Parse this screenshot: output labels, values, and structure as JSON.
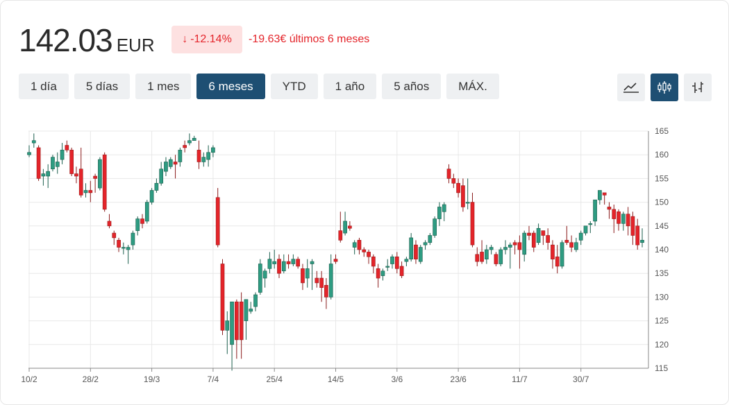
{
  "header": {
    "price": "142.03",
    "currency": "EUR",
    "change_pct": "-12.14%",
    "change_abs": "-19.63€ últimos 6 meses",
    "down_color": "#e4242a"
  },
  "ranges": [
    {
      "label": "1 día",
      "active": false
    },
    {
      "label": "5 días",
      "active": false
    },
    {
      "label": "1 mes",
      "active": false
    },
    {
      "label": "6 meses",
      "active": true
    },
    {
      "label": "YTD",
      "active": false
    },
    {
      "label": "1 año",
      "active": false
    },
    {
      "label": "5 años",
      "active": false
    },
    {
      "label": "MÁX.",
      "active": false
    }
  ],
  "chart_types": [
    {
      "name": "line-chart-icon",
      "active": false
    },
    {
      "name": "candlestick-chart-icon",
      "active": true
    },
    {
      "name": "ohlc-chart-icon",
      "active": false
    }
  ],
  "chart_data": {
    "type": "candlestick",
    "up_color": "#2e9c82",
    "down_color": "#e4242a",
    "ylim": [
      115,
      165
    ],
    "yticks": [
      115,
      120,
      125,
      130,
      135,
      140,
      145,
      150,
      155,
      160,
      165
    ],
    "xticks": [
      {
        "label": "10/2",
        "index": 0
      },
      {
        "label": "28/2",
        "index": 13
      },
      {
        "label": "19/3",
        "index": 26
      },
      {
        "label": "7/4",
        "index": 39
      },
      {
        "label": "25/4",
        "index": 52
      },
      {
        "label": "14/5",
        "index": 65
      },
      {
        "label": "3/6",
        "index": 78
      },
      {
        "label": "23/6",
        "index": 91
      },
      {
        "label": "11/7",
        "index": 104
      },
      {
        "label": "30/7",
        "index": 117
      }
    ],
    "candles": [
      [
        160,
        162,
        160.5,
        159.5
      ],
      [
        162.5,
        164.5,
        163,
        161.5
      ],
      [
        161.5,
        162,
        155,
        154.5
      ],
      [
        155.5,
        157,
        156,
        153.5
      ],
      [
        155.5,
        158,
        156.5,
        153
      ],
      [
        157,
        160,
        159.5,
        156.5
      ],
      [
        157.5,
        160.5,
        158.5,
        156
      ],
      [
        159,
        162.5,
        161,
        158
      ],
      [
        162,
        163,
        161,
        160.5
      ],
      [
        161,
        161.5,
        156,
        155.5
      ],
      [
        156,
        157.5,
        155.5,
        154
      ],
      [
        157,
        161.5,
        151.5,
        151
      ],
      [
        152,
        154,
        152.5,
        151
      ],
      [
        152.5,
        154.5,
        152,
        150
      ],
      [
        155.5,
        156,
        155,
        152
      ],
      [
        153,
        159.5,
        159,
        152.5
      ],
      [
        160,
        160.5,
        148.5,
        148
      ],
      [
        146,
        147.5,
        145,
        144.5
      ],
      [
        143.5,
        144,
        142.5,
        141
      ],
      [
        142,
        142.5,
        140.5,
        139.5
      ],
      [
        140.5,
        141.5,
        140.5,
        139
      ],
      [
        140,
        141,
        140.5,
        137
      ],
      [
        141,
        144,
        143.5,
        140
      ],
      [
        144,
        147,
        146.5,
        143
      ],
      [
        146.5,
        147.5,
        145.5,
        144.5
      ],
      [
        146,
        150.5,
        150,
        145.5
      ],
      [
        150,
        153,
        152.5,
        149.5
      ],
      [
        152.5,
        155,
        154,
        152
      ],
      [
        154,
        158.5,
        157,
        153.5
      ],
      [
        156.5,
        159.5,
        158.5,
        155.5
      ],
      [
        157.5,
        159.5,
        159,
        157
      ],
      [
        158.5,
        160,
        158,
        155
      ],
      [
        158.5,
        161.5,
        161,
        157.5
      ],
      [
        162,
        163,
        161.5,
        160.5
      ],
      [
        162.5,
        164.5,
        163,
        162
      ],
      [
        163,
        164,
        163.5,
        163
      ],
      [
        161,
        163,
        158.5,
        157
      ],
      [
        158.5,
        160.5,
        159.5,
        157.5
      ],
      [
        159,
        162,
        160.5,
        157.5
      ],
      [
        160.5,
        162,
        161.5,
        159.5
      ],
      [
        151,
        153,
        141,
        140.5
      ],
      [
        137,
        138,
        123,
        122
      ],
      [
        123,
        127,
        125,
        118
      ],
      [
        120,
        129,
        129,
        114.5
      ],
      [
        129,
        129.5,
        121,
        117
      ],
      [
        129,
        131,
        121,
        117
      ],
      [
        125,
        128,
        129.5,
        121
      ],
      [
        127,
        129,
        127.5,
        126.5
      ],
      [
        128,
        131,
        130.5,
        127
      ],
      [
        131,
        138,
        137,
        130.5
      ],
      [
        134,
        136,
        135.5,
        132
      ],
      [
        136,
        139.5,
        138,
        135
      ],
      [
        137,
        140,
        137.5,
        136
      ],
      [
        138,
        139,
        135,
        134
      ],
      [
        135.5,
        139,
        137.5,
        135
      ],
      [
        137.5,
        139,
        137,
        136
      ],
      [
        137,
        139,
        138,
        136.5
      ],
      [
        138,
        138.5,
        136.5,
        136
      ],
      [
        136,
        137,
        133,
        131.5
      ],
      [
        134,
        138,
        136,
        132
      ],
      [
        137,
        138,
        137.5,
        131.5
      ],
      [
        134,
        135.5,
        133,
        132
      ],
      [
        134,
        135.5,
        132,
        129
      ],
      [
        132.5,
        134,
        130,
        127.5
      ],
      [
        130,
        139,
        137,
        129.5
      ],
      [
        138,
        139,
        137.5,
        137
      ],
      [
        144,
        148,
        142,
        141.5
      ],
      [
        143.5,
        148,
        146,
        143
      ],
      [
        145,
        146,
        144.5,
        144
      ],
      [
        140.5,
        142,
        141.5,
        139
      ],
      [
        142,
        142.5,
        140,
        139
      ],
      [
        140,
        140.5,
        139.5,
        138.5
      ],
      [
        139.5,
        140,
        138.5,
        137
      ],
      [
        138.5,
        139,
        136.5,
        135
      ],
      [
        136,
        137,
        134,
        132
      ],
      [
        134.5,
        136,
        135.5,
        133.5
      ],
      [
        136.5,
        138,
        136.5,
        135.5
      ],
      [
        137,
        139,
        138.5,
        136
      ],
      [
        138.5,
        139.5,
        136,
        135
      ],
      [
        136.5,
        137.5,
        134.5,
        134
      ],
      [
        137.5,
        138.5,
        138,
        136.5
      ],
      [
        138,
        143.5,
        142.5,
        137.5
      ],
      [
        141,
        142,
        138,
        137
      ],
      [
        137.5,
        141,
        140.5,
        137
      ],
      [
        141,
        142,
        141.5,
        140
      ],
      [
        141.5,
        143.5,
        143,
        141
      ],
      [
        143,
        147,
        146.5,
        142.5
      ],
      [
        146.5,
        150,
        149,
        145
      ],
      [
        148,
        150,
        149.5,
        146
      ],
      [
        157,
        158,
        155,
        154
      ],
      [
        155,
        156,
        154,
        153
      ],
      [
        154,
        155,
        152,
        151
      ],
      [
        153.5,
        155,
        149,
        148
      ],
      [
        150,
        155,
        150,
        148.5
      ],
      [
        150,
        152,
        141,
        140.5
      ],
      [
        139,
        140.5,
        137.5,
        136.5
      ],
      [
        139.5,
        142,
        137.5,
        137
      ],
      [
        138,
        141,
        140,
        137
      ],
      [
        140,
        141,
        140.5,
        139
      ],
      [
        139,
        139.5,
        137,
        136.5
      ],
      [
        137,
        140.5,
        140,
        136.5
      ],
      [
        140,
        142,
        140.5,
        139
      ],
      [
        140.5,
        141.5,
        141,
        136
      ],
      [
        141.5,
        142,
        141,
        139
      ],
      [
        141.5,
        143,
        140,
        136
      ],
      [
        139,
        144,
        143.5,
        137.5
      ],
      [
        143.5,
        145,
        143,
        142
      ],
      [
        143.5,
        144,
        140.5,
        139.5
      ],
      [
        141.5,
        145.5,
        144.5,
        141
      ],
      [
        144,
        144,
        143,
        141
      ],
      [
        143,
        144.5,
        141.5,
        140
      ],
      [
        141,
        142,
        138,
        136
      ],
      [
        138.5,
        141,
        136.5,
        135
      ],
      [
        136.5,
        142,
        141.5,
        136
      ],
      [
        142,
        145,
        141.5,
        141
      ],
      [
        141.5,
        143,
        140.5,
        139.5
      ],
      [
        140,
        142.5,
        141.5,
        139.5
      ],
      [
        142,
        144,
        143.5,
        141
      ],
      [
        143.5,
        145,
        145,
        143
      ],
      [
        145.5,
        146,
        145.5,
        143.5
      ],
      [
        146,
        150.5,
        150.5,
        145
      ],
      [
        150.5,
        152.5,
        152.5,
        149.5
      ],
      [
        152,
        151.5,
        151.5,
        149.5
      ],
      [
        149,
        150,
        148.5,
        146.5
      ],
      [
        148.5,
        149.5,
        146.5,
        143.5
      ],
      [
        148,
        148.5,
        145.5,
        144
      ],
      [
        145.5,
        148,
        147.5,
        144
      ],
      [
        147.5,
        149,
        145,
        143
      ],
      [
        147,
        148,
        143,
        141
      ],
      [
        145,
        146.5,
        141,
        140
      ],
      [
        141.5,
        144.5,
        142,
        140.5
      ]
    ]
  }
}
